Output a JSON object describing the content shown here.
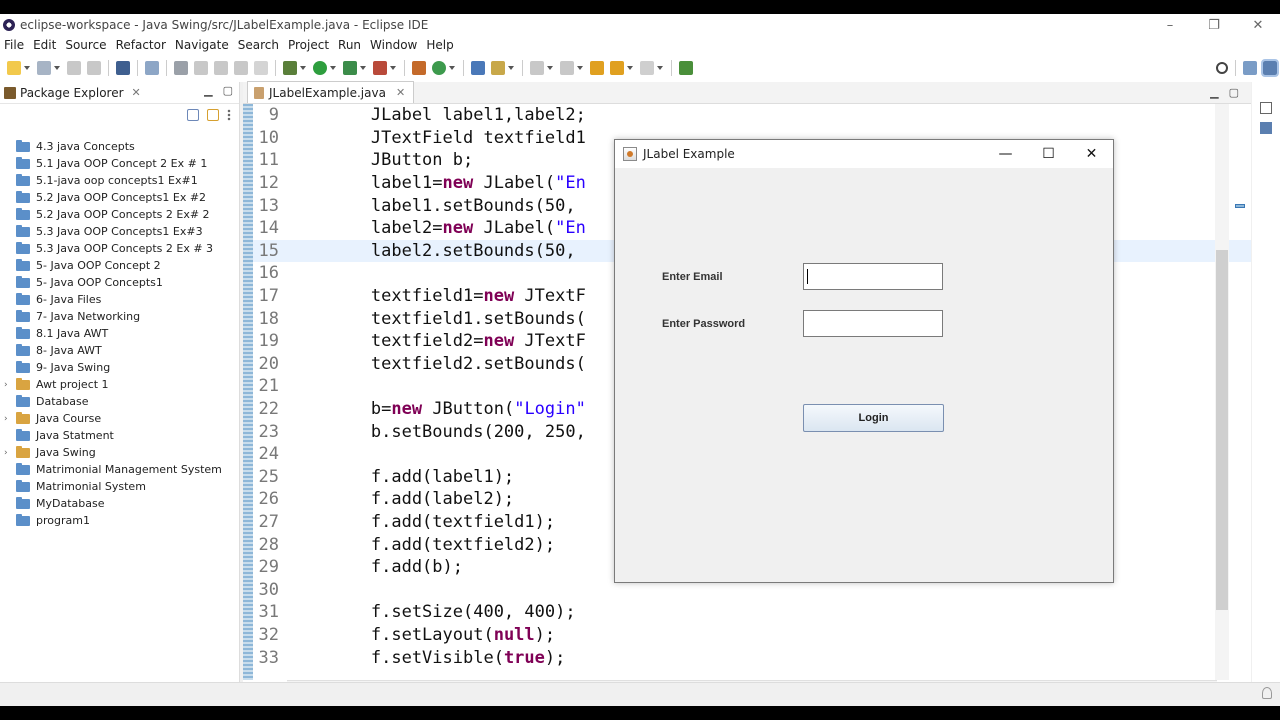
{
  "window": {
    "title": "eclipse-workspace - Java Swing/src/JLabelExample.java - Eclipse IDE"
  },
  "window_controls": [
    "–",
    "❐",
    "✕"
  ],
  "menu": [
    "File",
    "Edit",
    "Source",
    "Refactor",
    "Navigate",
    "Search",
    "Project",
    "Run",
    "Window",
    "Help"
  ],
  "package_explorer": {
    "title": "Package Explorer",
    "items": [
      {
        "label": "4.3 java Concepts",
        "type": "folder",
        "expandable": false
      },
      {
        "label": "5.1 Java OOP Concept 2 Ex # 1",
        "type": "folder",
        "expandable": false
      },
      {
        "label": "5.1-java oop concepts1 Ex#1",
        "type": "folder",
        "expandable": false
      },
      {
        "label": "5.2 Java OOP Concepts1 Ex #2",
        "type": "folder",
        "expandable": false
      },
      {
        "label": "5.2 Java OOP Concepts 2 Ex# 2",
        "type": "folder",
        "expandable": false
      },
      {
        "label": "5.3 Java OOP Concepts1 Ex#3",
        "type": "folder",
        "expandable": false
      },
      {
        "label": "5.3 Java OOP Concepts 2 Ex # 3",
        "type": "folder",
        "expandable": false
      },
      {
        "label": "5- Java OOP Concept 2",
        "type": "folder",
        "expandable": false
      },
      {
        "label": "5- Java OOP Concepts1",
        "type": "folder",
        "expandable": false
      },
      {
        "label": "6- Java Files",
        "type": "folder",
        "expandable": false
      },
      {
        "label": "7- Java Networking",
        "type": "folder",
        "expandable": false
      },
      {
        "label": "8.1 Java AWT",
        "type": "folder",
        "expandable": false
      },
      {
        "label": "8- Java AWT",
        "type": "folder",
        "expandable": false
      },
      {
        "label": "9- Java Swing",
        "type": "folder",
        "expandable": false
      },
      {
        "label": "Awt project 1",
        "type": "project",
        "expandable": true
      },
      {
        "label": "Database",
        "type": "folder",
        "expandable": false
      },
      {
        "label": "Java Course",
        "type": "project",
        "expandable": true
      },
      {
        "label": "Java Statment",
        "type": "folder",
        "expandable": false
      },
      {
        "label": "Java Swing",
        "type": "project",
        "expandable": true
      },
      {
        "label": "Matrimonial Management System",
        "type": "folder",
        "expandable": false
      },
      {
        "label": "Matrimonial System",
        "type": "folder",
        "expandable": false
      },
      {
        "label": "MyDatabase",
        "type": "folder",
        "expandable": false
      },
      {
        "label": "program1",
        "type": "folder",
        "expandable": false
      }
    ]
  },
  "editor": {
    "tab": "JLabelExample.java",
    "highlighted_line": 15,
    "lines": [
      {
        "n": "9",
        "tokens": [
          [
            "        JLabel label1,label2;",
            "plain"
          ]
        ]
      },
      {
        "n": "10",
        "tokens": [
          [
            "        JTextField textfield1",
            "plain"
          ]
        ]
      },
      {
        "n": "11",
        "tokens": [
          [
            "        JButton b;",
            "plain"
          ]
        ]
      },
      {
        "n": "12",
        "tokens": [
          [
            "        label1=",
            "plain"
          ],
          [
            "new",
            "kw"
          ],
          [
            " JLabel(",
            "plain"
          ],
          [
            "\"En",
            "str"
          ]
        ]
      },
      {
        "n": "13",
        "tokens": [
          [
            "        label1.setBounds(50,",
            "plain"
          ]
        ]
      },
      {
        "n": "14",
        "tokens": [
          [
            "        label2=",
            "plain"
          ],
          [
            "new",
            "kw"
          ],
          [
            " JLabel(",
            "plain"
          ],
          [
            "\"En",
            "str"
          ]
        ]
      },
      {
        "n": "15",
        "tokens": [
          [
            "        label2.setBounds(50,",
            "plain"
          ]
        ]
      },
      {
        "n": "16",
        "tokens": [
          [
            "",
            "plain"
          ]
        ]
      },
      {
        "n": "17",
        "tokens": [
          [
            "        textfield1=",
            "plain"
          ],
          [
            "new",
            "kw"
          ],
          [
            " JTextF",
            "plain"
          ]
        ]
      },
      {
        "n": "18",
        "tokens": [
          [
            "        textfield1.setBounds(",
            "plain"
          ]
        ]
      },
      {
        "n": "19",
        "tokens": [
          [
            "        textfield2=",
            "plain"
          ],
          [
            "new",
            "kw"
          ],
          [
            " JTextF",
            "plain"
          ]
        ]
      },
      {
        "n": "20",
        "tokens": [
          [
            "        textfield2.setBounds(",
            "plain"
          ]
        ]
      },
      {
        "n": "21",
        "tokens": [
          [
            "",
            "plain"
          ]
        ]
      },
      {
        "n": "22",
        "tokens": [
          [
            "        b=",
            "plain"
          ],
          [
            "new",
            "kw"
          ],
          [
            " JButton(",
            "plain"
          ],
          [
            "\"Login\"",
            "str"
          ]
        ]
      },
      {
        "n": "23",
        "tokens": [
          [
            "        b.setBounds(200, 250,",
            "plain"
          ]
        ]
      },
      {
        "n": "24",
        "tokens": [
          [
            "",
            "plain"
          ]
        ]
      },
      {
        "n": "25",
        "tokens": [
          [
            "        f.add(label1);",
            "plain"
          ]
        ]
      },
      {
        "n": "26",
        "tokens": [
          [
            "        f.add(label2);",
            "plain"
          ]
        ]
      },
      {
        "n": "27",
        "tokens": [
          [
            "        f.add(textfield1);",
            "plain"
          ]
        ]
      },
      {
        "n": "28",
        "tokens": [
          [
            "        f.add(textfield2);",
            "plain"
          ]
        ]
      },
      {
        "n": "29",
        "tokens": [
          [
            "        f.add(b);",
            "plain"
          ]
        ]
      },
      {
        "n": "30",
        "tokens": [
          [
            "",
            "plain"
          ]
        ]
      },
      {
        "n": "31",
        "tokens": [
          [
            "        f.setSize(400, 400);",
            "plain"
          ]
        ]
      },
      {
        "n": "32",
        "tokens": [
          [
            "        f.setLayout(",
            "plain"
          ],
          [
            "null",
            "kw"
          ],
          [
            ");",
            "plain"
          ]
        ]
      },
      {
        "n": "33",
        "tokens": [
          [
            "        f.setVisible(",
            "plain"
          ],
          [
            "true",
            "kw"
          ],
          [
            ");",
            "plain"
          ]
        ]
      }
    ]
  },
  "swing_window": {
    "title": "JLabel Example",
    "controls": [
      "—",
      "☐",
      "✕"
    ],
    "email_label": "Enter Email",
    "email_value": "",
    "password_label": "Enter Password",
    "password_value": "",
    "button_label": "Login"
  },
  "colors": {
    "keyword": "#7f0055",
    "string": "#2a00ff",
    "line_highlight": "#e8f2fe"
  }
}
